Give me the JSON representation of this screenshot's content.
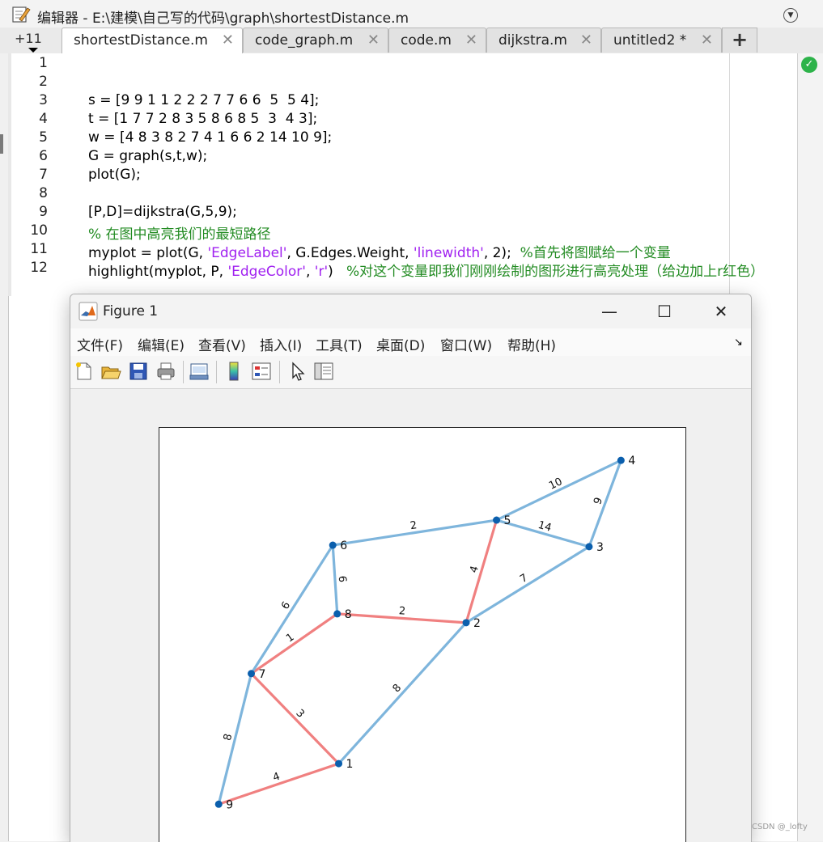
{
  "editor": {
    "title": "编辑器 - E:\\建模\\自己写的代码\\graph\\shortestDistance.m",
    "line_count_badge": "+11",
    "tabs": [
      {
        "label": "shortestDistance.m",
        "active": true
      },
      {
        "label": "code_graph.m"
      },
      {
        "label": "code.m"
      },
      {
        "label": "dijkstra.m"
      },
      {
        "label": "untitled2 *"
      }
    ],
    "close_glyph": "✕",
    "add_tab_glyph": "+",
    "line_numbers": [
      "1",
      "2",
      "3",
      "4",
      "5",
      "6",
      "7",
      "8",
      "9",
      "10",
      "11",
      "12"
    ],
    "code": {
      "l3": "s = [9 9 1 1 2 2 2 7 7 6 6  5  5 4];",
      "l4": "t = [1 7 7 2 8 3 5 8 6 8 5  3  4 3];",
      "l5": "w = [4 8 3 8 2 7 4 1 6 6 2 14 10 9];",
      "l6": "G = graph(s,t,w);",
      "l7": "plot(G);",
      "l9": "[P,D]=dijkstra(G,5,9);",
      "l10_comment": "% 在图中高亮我们的最短路径",
      "l11_a": "myplot = plot(G, ",
      "l11_s1": "'EdgeLabel'",
      "l11_b": ", G.Edges.Weight, ",
      "l11_s2": "'linewidth'",
      "l11_c": ", 2);  ",
      "l11_comment": "%首先将图赋给一个变量",
      "l12_a": "highlight(myplot, P, ",
      "l12_s1": "'EdgeColor'",
      "l12_b": ", ",
      "l12_s2": "'r'",
      "l12_c": ")   ",
      "l12_comment": "%对这个变量即我们刚刚绘制的图形进行高亮处理（给边加上r红色）"
    }
  },
  "figure": {
    "title": "Figure 1",
    "controls": {
      "minimize": "—",
      "maximize": "☐",
      "close": "✕"
    },
    "menu": [
      "文件(F)",
      "编辑(E)",
      "查看(V)",
      "插入(I)",
      "工具(T)",
      "桌面(D)",
      "窗口(W)",
      "帮助(H)"
    ],
    "dock_glyph": "↘",
    "toolbar": [
      "new-figure",
      "open-file",
      "save",
      "print",
      "link-plot",
      "colorbar",
      "legend",
      "edit-plot",
      "property-inspector"
    ]
  },
  "chart_data": {
    "type": "graph",
    "nodes": [
      {
        "id": "1",
        "x": 0.62,
        "y": -3.25
      },
      {
        "id": "2",
        "x": 2.34,
        "y": -1.34
      },
      {
        "id": "3",
        "x": 4.0,
        "y": -0.31
      },
      {
        "id": "4",
        "x": 4.43,
        "y": 0.86
      },
      {
        "id": "5",
        "x": 2.75,
        "y": 0.05
      },
      {
        "id": "6",
        "x": 0.54,
        "y": -0.29
      },
      {
        "id": "7",
        "x": -0.56,
        "y": -2.03
      },
      {
        "id": "8",
        "x": 0.6,
        "y": -1.22
      },
      {
        "id": "9",
        "x": -1.0,
        "y": -3.8
      }
    ],
    "edges": [
      {
        "s": "9",
        "t": "1",
        "w": "4",
        "highlight": true
      },
      {
        "s": "9",
        "t": "7",
        "w": "8",
        "highlight": false
      },
      {
        "s": "1",
        "t": "7",
        "w": "3",
        "highlight": true
      },
      {
        "s": "1",
        "t": "2",
        "w": "8",
        "highlight": false
      },
      {
        "s": "2",
        "t": "8",
        "w": "2",
        "highlight": true
      },
      {
        "s": "2",
        "t": "3",
        "w": "7",
        "highlight": false
      },
      {
        "s": "2",
        "t": "5",
        "w": "4",
        "highlight": true
      },
      {
        "s": "7",
        "t": "8",
        "w": "1",
        "highlight": true
      },
      {
        "s": "7",
        "t": "6",
        "w": "6",
        "highlight": false
      },
      {
        "s": "6",
        "t": "8",
        "w": "6",
        "highlight": false
      },
      {
        "s": "6",
        "t": "5",
        "w": "2",
        "highlight": false
      },
      {
        "s": "5",
        "t": "3",
        "w": "14",
        "highlight": false
      },
      {
        "s": "5",
        "t": "4",
        "w": "10",
        "highlight": false
      },
      {
        "s": "4",
        "t": "3",
        "w": "9",
        "highlight": false
      }
    ],
    "xlim": [
      -1.8,
      5.3
    ],
    "ylim": [
      -4.4,
      1.3
    ],
    "colors": {
      "edge": "#7eb5dc",
      "highlight": "#f08080",
      "node": "#0b5fad"
    }
  },
  "watermark": "CSDN @_lofty"
}
